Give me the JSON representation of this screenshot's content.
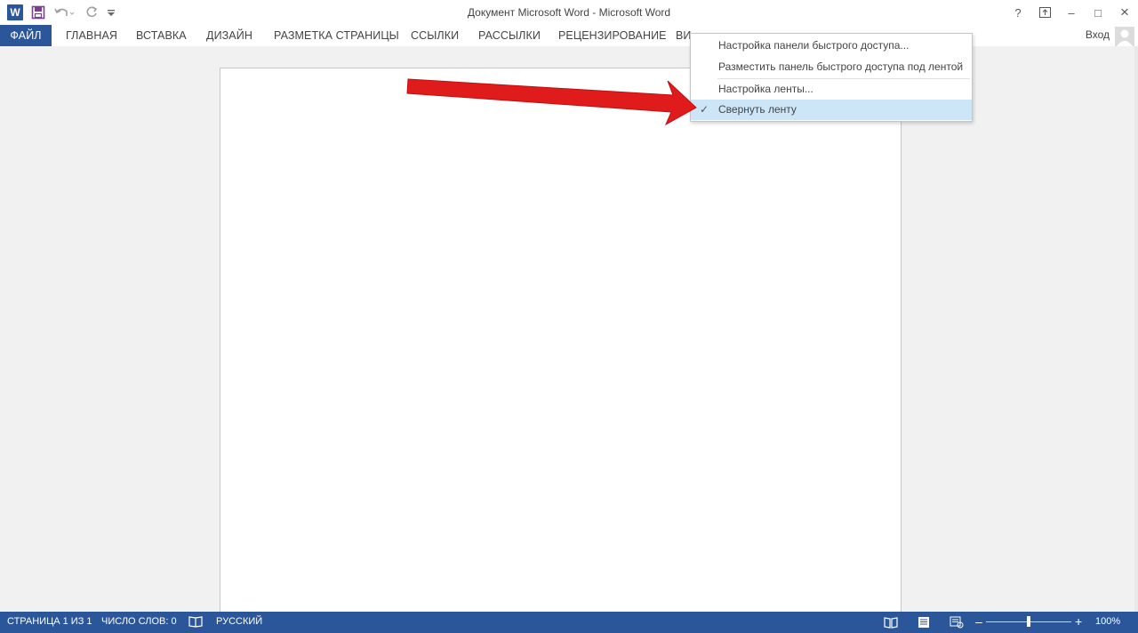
{
  "window": {
    "title": "Документ Microsoft Word - Microsoft Word",
    "controls": {
      "help": "?",
      "minimize": "–",
      "maximize": "□",
      "close": "×"
    }
  },
  "qat": {
    "logo_letter": "W",
    "icons": [
      "word-logo-icon",
      "save-icon",
      "undo-icon",
      "redo-icon",
      "customize-qat-icon"
    ]
  },
  "tabs": [
    {
      "label": "ФАЙЛ"
    },
    {
      "label": "ГЛАВНАЯ"
    },
    {
      "label": "ВСТАВКА"
    },
    {
      "label": "ДИЗАЙН"
    },
    {
      "label": "РАЗМЕТКА СТРАНИЦЫ"
    },
    {
      "label": "ССЫЛКИ"
    },
    {
      "label": "РАССЫЛКИ"
    },
    {
      "label": "РЕЦЕНЗИРОВАНИЕ"
    },
    {
      "label": "ВИ"
    }
  ],
  "signin": "Вход",
  "menu": {
    "items": [
      {
        "label": "Настройка панели быстрого доступа..."
      },
      {
        "label": "Разместить панель быстрого доступа под лентой"
      },
      {
        "label": "Настройка ленты..."
      },
      {
        "label": "Свернуть ленту",
        "checked": true,
        "highlighted": true
      }
    ],
    "check_glyph": "✓"
  },
  "status": {
    "page": "СТРАНИЦА 1 ИЗ 1",
    "words": "ЧИСЛО СЛОВ: 0",
    "language": "РУССКИЙ",
    "zoom_minus": "–",
    "zoom_plus": "+",
    "zoom": "100%"
  },
  "colors": {
    "accent": "#2b579a",
    "menu_highlight": "#cde6f7",
    "arrow": "#e01b1b"
  }
}
